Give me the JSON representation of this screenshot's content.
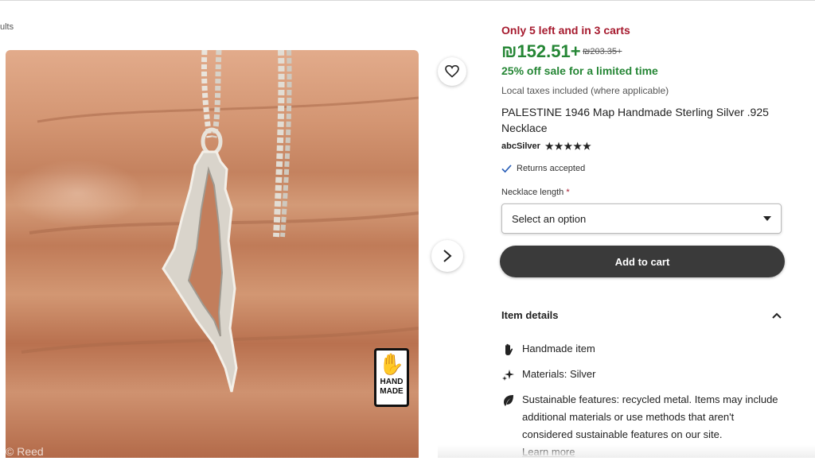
{
  "breadcrumb": {
    "text": "ults"
  },
  "image": {
    "badge_line1": "HAND",
    "badge_line2": "MADE",
    "watermark": "© Reed"
  },
  "listing": {
    "stock_text": "Only 5 left and in 3 carts",
    "price": "₪152.51+",
    "original_price": "₪203.35+",
    "sale_text": "25% off sale for a limited time",
    "taxes_note": "Local taxes included (where applicable)",
    "title": "PALESTINE 1946 Map Handmade Sterling Silver .925 Necklace",
    "shop_name": "abcSilver",
    "stars": "★★★★★",
    "returns_text": "Returns accepted"
  },
  "option": {
    "label": "Necklace length",
    "required_mark": "*",
    "selected": "Select an option"
  },
  "cart": {
    "button_label": "Add to cart"
  },
  "details": {
    "heading": "Item details",
    "items": [
      "Handmade item",
      "Materials: Silver",
      "Sustainable features: recycled metal. Items may include additional materials or use methods that aren't considered sustainable features on our site."
    ],
    "learn_more": "Learn more"
  },
  "icons": {
    "favorite": "heart-icon",
    "next": "chevron-right-icon",
    "dropdown": "caret-down-icon",
    "collapse": "chevron-up-icon",
    "returns": "check-icon",
    "handmade": "hand-icon",
    "materials": "sparkle-icon",
    "sustainable": "leaf-icon"
  },
  "colors": {
    "stock": "#a61a2e",
    "price": "#258635",
    "cart_button": "#3a3a3a"
  }
}
